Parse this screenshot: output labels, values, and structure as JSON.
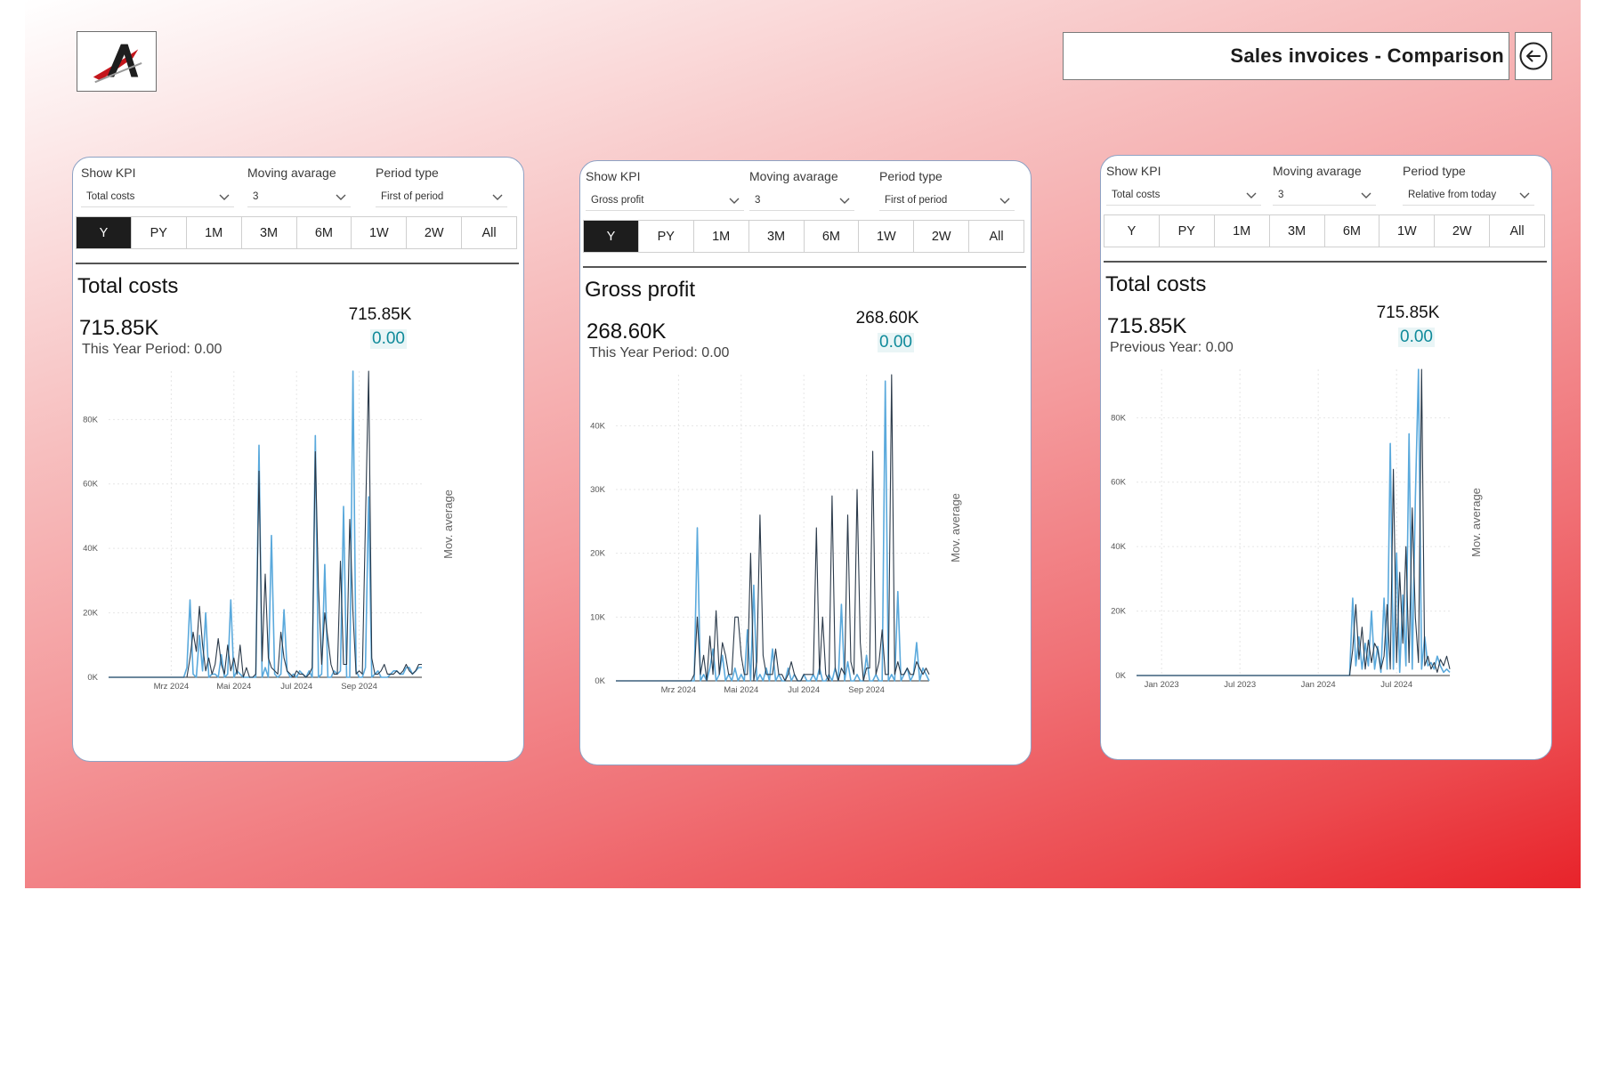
{
  "header": {
    "title": "Sales invoices - Comparison",
    "back_icon": "arrow-left-circle-icon",
    "logo_icon": "company-logo-icon"
  },
  "colors": {
    "accent_red": "#e8232a",
    "current_series": "#5aa9dc",
    "moving_average_series": "#2b3a4a",
    "delta_text": "#0f8a9a",
    "active_period_bg": "#1d1d1d"
  },
  "cards": [
    {
      "show_kpi_label": "Show KPI",
      "show_kpi_value": "Total costs",
      "moving_average_label": "Moving avarage",
      "moving_average_value": "3",
      "period_type_label": "Period type",
      "period_type_value": "First of period",
      "periods": [
        "Y",
        "PY",
        "1M",
        "3M",
        "6M",
        "1W",
        "2W",
        "All"
      ],
      "active_period": "Y",
      "kpi_title": "Total costs",
      "kpi_value": "715.85K",
      "kpi_subtitle": "This Year Period: 0.00",
      "compare_value": "715.85K",
      "compare_delta": "0.00"
    },
    {
      "show_kpi_label": "Show KPI",
      "show_kpi_value": "Gross profit",
      "moving_average_label": "Moving avarage",
      "moving_average_value": "3",
      "period_type_label": "Period type",
      "period_type_value": "First of period",
      "periods": [
        "Y",
        "PY",
        "1M",
        "3M",
        "6M",
        "1W",
        "2W",
        "All"
      ],
      "active_period": "Y",
      "kpi_title": "Gross profit",
      "kpi_value": "268.60K",
      "kpi_subtitle": "This Year Period: 0.00",
      "compare_value": "268.60K",
      "compare_delta": "0.00"
    },
    {
      "show_kpi_label": "Show KPI",
      "show_kpi_value": "Total costs",
      "moving_average_label": "Moving avarage",
      "moving_average_value": "3",
      "period_type_label": "Period type",
      "period_type_value": "Relative from today",
      "periods": [
        "Y",
        "PY",
        "1M",
        "3M",
        "6M",
        "1W",
        "2W",
        "All"
      ],
      "active_period": "",
      "kpi_title": "Total costs",
      "kpi_value": "715.85K",
      "kpi_subtitle": "Previous Year: 0.00",
      "compare_value": "715.85K",
      "compare_delta": "0.00"
    }
  ],
  "chart_data": [
    {
      "type": "line",
      "y_axis_label": "Mov. average",
      "y_ticks": [
        "0K",
        "20K",
        "40K",
        "60K",
        "80K"
      ],
      "ylim": [
        0,
        95
      ],
      "x_range": [
        0,
        100
      ],
      "x_ticks": [
        {
          "x": 20,
          "label": "Mrz 2024"
        },
        {
          "x": 40,
          "label": "Mai 2024"
        },
        {
          "x": 60,
          "label": "Jul 2024"
        },
        {
          "x": 80,
          "label": "Sep 2024"
        }
      ],
      "series": [
        {
          "x": [
            0,
            24,
            25,
            26,
            27,
            28,
            29,
            30,
            31,
            32,
            33,
            34,
            35,
            36,
            37,
            38,
            39,
            40,
            41,
            42,
            43,
            44,
            45,
            46,
            47,
            48,
            49,
            50,
            51,
            52,
            53,
            54,
            55,
            56,
            57,
            58,
            59,
            60,
            61,
            62,
            63,
            64,
            65,
            66,
            67,
            68,
            69,
            70,
            71,
            72,
            73,
            74,
            75,
            76,
            77,
            78,
            79,
            80,
            81,
            82,
            83,
            84,
            85,
            86,
            87,
            88,
            89,
            90,
            91,
            92,
            93,
            94,
            95,
            96,
            97,
            98,
            99,
            100
          ],
          "values": [
            0,
            0,
            3,
            24,
            1,
            0,
            13,
            2,
            20,
            0,
            1,
            1,
            0,
            7,
            0,
            1,
            24,
            0,
            2,
            1,
            0,
            0,
            0,
            0,
            0,
            72,
            0,
            3,
            0,
            44,
            1,
            0,
            1,
            21,
            2,
            0,
            1,
            0,
            2,
            1,
            0,
            2,
            0,
            75,
            0,
            1,
            35,
            0,
            0,
            2,
            1,
            2,
            53,
            0,
            0,
            95,
            2,
            0,
            0,
            3,
            56,
            0,
            1,
            2,
            0,
            0,
            0,
            1,
            2,
            2,
            1,
            1,
            3,
            3,
            1,
            2,
            3,
            3
          ]
        },
        {
          "x": [
            0,
            24,
            25,
            26,
            27,
            28,
            29,
            30,
            31,
            32,
            33,
            34,
            35,
            36,
            37,
            38,
            39,
            40,
            41,
            42,
            43,
            44,
            45,
            46,
            47,
            48,
            49,
            50,
            51,
            52,
            53,
            54,
            55,
            56,
            57,
            58,
            59,
            60,
            61,
            62,
            63,
            64,
            65,
            66,
            67,
            68,
            69,
            70,
            71,
            72,
            73,
            74,
            75,
            76,
            77,
            78,
            79,
            80,
            81,
            82,
            83,
            84,
            85,
            86,
            87,
            88,
            89,
            90,
            91,
            92,
            93,
            94,
            95,
            96,
            97,
            98,
            99,
            100
          ],
          "values": [
            0,
            0,
            0,
            6,
            14,
            8,
            22,
            10,
            2,
            6,
            1,
            4,
            12,
            4,
            1,
            10,
            2,
            6,
            1,
            10,
            0,
            3,
            0,
            0,
            1,
            64,
            5,
            32,
            6,
            3,
            2,
            1,
            14,
            6,
            2,
            1,
            0,
            2,
            1,
            1,
            0,
            1,
            3,
            70,
            28,
            4,
            20,
            12,
            4,
            1,
            1,
            36,
            4,
            4,
            49,
            20,
            1,
            2,
            1,
            48,
            95,
            6,
            1,
            1,
            2,
            4,
            1,
            1,
            1,
            2,
            1,
            2,
            4,
            2,
            1,
            2,
            4,
            4
          ]
        }
      ]
    },
    {
      "type": "line",
      "y_axis_label": "Mov. average",
      "y_ticks": [
        "0K",
        "10K",
        "20K",
        "30K",
        "40K"
      ],
      "ylim": [
        0,
        48
      ],
      "x_range": [
        0,
        100
      ],
      "x_ticks": [
        {
          "x": 20,
          "label": "Mrz 2024"
        },
        {
          "x": 40,
          "label": "Mai 2024"
        },
        {
          "x": 60,
          "label": "Jul 2024"
        },
        {
          "x": 80,
          "label": "Sep 2024"
        }
      ],
      "series": [
        {
          "x": [
            0,
            24,
            25,
            26,
            27,
            28,
            29,
            30,
            31,
            32,
            33,
            34,
            35,
            36,
            37,
            38,
            39,
            40,
            41,
            42,
            43,
            44,
            45,
            46,
            47,
            48,
            49,
            50,
            51,
            52,
            53,
            54,
            55,
            56,
            57,
            58,
            59,
            60,
            61,
            62,
            63,
            64,
            65,
            66,
            67,
            68,
            69,
            70,
            71,
            72,
            73,
            74,
            75,
            76,
            77,
            78,
            79,
            80,
            81,
            82,
            83,
            84,
            85,
            86,
            87,
            88,
            89,
            90,
            91,
            92,
            93,
            94,
            95,
            96,
            97,
            98,
            99,
            100
          ],
          "values": [
            0,
            0,
            0,
            24,
            0,
            1,
            0,
            2,
            5,
            0,
            1,
            4,
            0,
            1,
            0,
            2,
            0,
            1,
            0,
            8,
            0,
            15,
            0,
            1,
            0,
            2,
            0,
            5,
            0,
            1,
            0,
            0,
            2,
            0,
            1,
            0,
            0,
            1,
            0,
            0,
            1,
            0,
            2,
            0,
            0,
            1,
            0,
            2,
            0,
            12,
            0,
            3,
            0,
            0,
            1,
            0,
            0,
            4,
            0,
            0,
            1,
            0,
            0,
            47,
            0,
            1,
            0,
            14,
            0,
            1,
            2,
            0,
            1,
            6,
            0,
            2,
            1,
            0
          ]
        },
        {
          "x": [
            0,
            24,
            25,
            26,
            27,
            28,
            29,
            30,
            31,
            32,
            33,
            34,
            35,
            36,
            37,
            38,
            39,
            40,
            41,
            42,
            43,
            44,
            45,
            46,
            47,
            48,
            49,
            50,
            51,
            52,
            53,
            54,
            55,
            56,
            57,
            58,
            59,
            60,
            61,
            62,
            63,
            64,
            65,
            66,
            67,
            68,
            69,
            70,
            71,
            72,
            73,
            74,
            75,
            76,
            77,
            78,
            79,
            80,
            81,
            82,
            83,
            84,
            85,
            86,
            87,
            88,
            89,
            90,
            91,
            92,
            93,
            94,
            95,
            96,
            97,
            98,
            99,
            100
          ],
          "values": [
            0,
            0,
            1,
            10,
            1,
            4,
            0,
            7,
            1,
            11,
            1,
            6,
            4,
            1,
            1,
            10,
            10,
            4,
            1,
            1,
            20,
            0,
            3,
            26,
            4,
            1,
            1,
            1,
            5,
            1,
            1,
            0,
            1,
            3,
            1,
            0,
            0,
            1,
            1,
            1,
            1,
            24,
            1,
            10,
            1,
            0,
            29,
            2,
            0,
            2,
            1,
            26,
            3,
            1,
            30,
            6,
            0,
            2,
            2,
            36,
            1,
            3,
            8,
            1,
            1,
            48,
            1,
            3,
            1,
            1,
            2,
            1,
            1,
            3,
            2,
            1,
            2,
            1
          ]
        }
      ]
    },
    {
      "type": "line",
      "y_axis_label": "Mov. average",
      "y_ticks": [
        "0K",
        "20K",
        "40K",
        "60K",
        "80K"
      ],
      "ylim": [
        0,
        95
      ],
      "x_range": [
        0,
        100
      ],
      "x_ticks": [
        {
          "x": 8,
          "label": "Jan 2023"
        },
        {
          "x": 33,
          "label": "Jul 2023"
        },
        {
          "x": 58,
          "label": "Jan 2024"
        },
        {
          "x": 83,
          "label": "Jul 2024"
        }
      ],
      "series": [
        {
          "x": [
            0,
            68,
            69,
            70,
            71,
            72,
            73,
            74,
            75,
            76,
            77,
            78,
            79,
            80,
            81,
            82,
            83,
            84,
            85,
            86,
            87,
            88,
            89,
            90,
            91,
            92,
            93,
            94,
            95,
            96,
            97,
            98,
            99,
            100
          ],
          "values": [
            0,
            0,
            24,
            3,
            12,
            2,
            10,
            3,
            20,
            2,
            9,
            1,
            24,
            2,
            72,
            2,
            38,
            1,
            25,
            3,
            75,
            2,
            55,
            95,
            2,
            12,
            3,
            4,
            2,
            6,
            3,
            1,
            2,
            1
          ]
        },
        {
          "x": [
            0,
            68,
            69,
            70,
            71,
            72,
            73,
            74,
            75,
            76,
            77,
            78,
            79,
            80,
            81,
            82,
            83,
            84,
            85,
            86,
            87,
            88,
            89,
            90,
            91,
            92,
            93,
            94,
            95,
            96,
            97,
            98,
            99,
            100
          ],
          "values": [
            0,
            0,
            8,
            22,
            5,
            15,
            2,
            11,
            4,
            10,
            8,
            2,
            6,
            22,
            2,
            64,
            4,
            32,
            10,
            40,
            4,
            52,
            18,
            4,
            95,
            3,
            6,
            2,
            4,
            1,
            5,
            3,
            6,
            2
          ]
        }
      ]
    }
  ]
}
